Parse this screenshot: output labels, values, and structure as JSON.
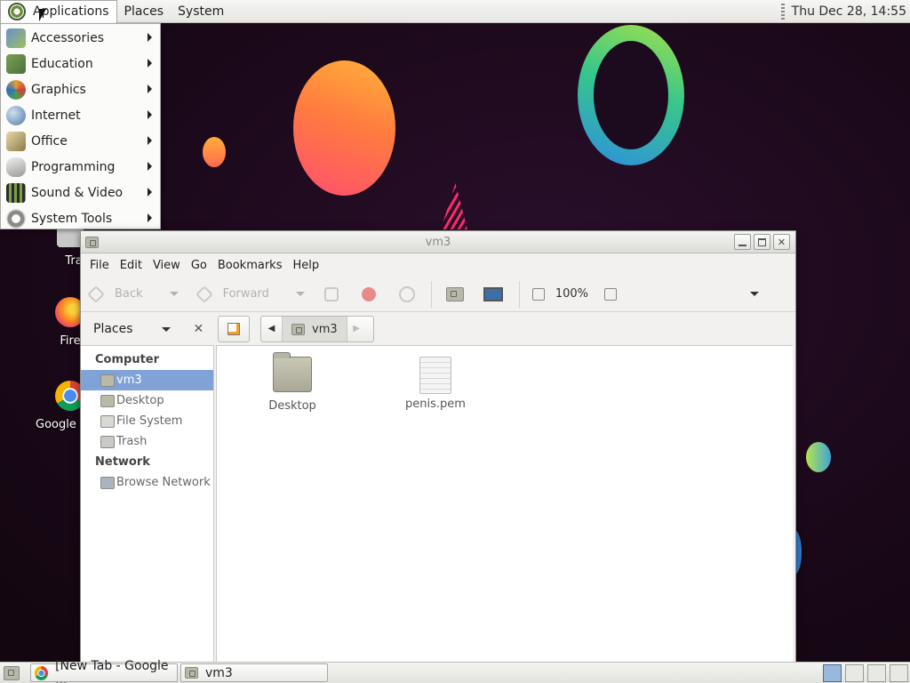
{
  "top_panel": {
    "applications_label": "Applications",
    "places_label": "Places",
    "system_label": "System",
    "clock": "Thu Dec 28, 14:55"
  },
  "apps_menu": {
    "items": [
      {
        "label": "Accessories",
        "icon": "accessories-icon"
      },
      {
        "label": "Education",
        "icon": "education-icon"
      },
      {
        "label": "Graphics",
        "icon": "graphics-icon"
      },
      {
        "label": "Internet",
        "icon": "internet-icon"
      },
      {
        "label": "Office",
        "icon": "office-icon"
      },
      {
        "label": "Programming",
        "icon": "programming-icon"
      },
      {
        "label": "Sound & Video",
        "icon": "sound-video-icon"
      },
      {
        "label": "System Tools",
        "icon": "system-tools-icon"
      }
    ]
  },
  "desktop": {
    "icons": [
      {
        "label": "Tra",
        "icon": "trash-icon"
      },
      {
        "label": "Fire",
        "icon": "firefox-icon"
      },
      {
        "label": "Google",
        "icon": "chrome-icon"
      }
    ]
  },
  "file_manager": {
    "title": "vm3",
    "menubar": [
      "File",
      "Edit",
      "View",
      "Go",
      "Bookmarks",
      "Help"
    ],
    "toolbar": {
      "back_label": "Back",
      "forward_label": "Forward",
      "zoom": "100%"
    },
    "sidebar": {
      "header": "Places",
      "sections": [
        {
          "title": "Computer",
          "items": [
            "vm3",
            "Desktop",
            "File System",
            "Trash"
          ]
        },
        {
          "title": "Network",
          "items": [
            "Browse Network"
          ]
        }
      ],
      "selected": "vm3"
    },
    "path": {
      "current": "vm3"
    },
    "files": [
      {
        "name": "Desktop",
        "type": "folder"
      },
      {
        "name": "penis.pem",
        "type": "file"
      }
    ]
  },
  "taskbar": {
    "tasks": [
      {
        "label": "[New Tab - Google ...",
        "icon": "chrome-icon"
      },
      {
        "label": "vm3",
        "icon": "folder-icon"
      }
    ],
    "workspace_count": 4,
    "active_workspace": 1
  }
}
